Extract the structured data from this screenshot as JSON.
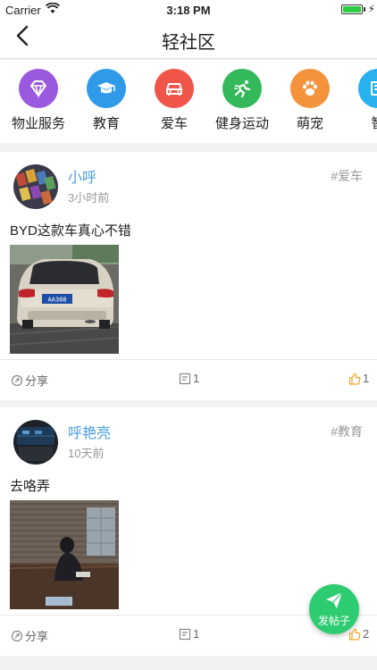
{
  "status_bar": {
    "carrier": "Carrier",
    "time": "3:18 PM"
  },
  "nav": {
    "title": "轻社区",
    "back_icon": "chevron-left-icon"
  },
  "categories": [
    {
      "label": "物业服务",
      "icon": "diamond-icon",
      "color": "#9b59e0"
    },
    {
      "label": "教育",
      "icon": "graduation-cap-icon",
      "color": "#2f9be8"
    },
    {
      "label": "爱车",
      "icon": "car-icon",
      "color": "#f0554a"
    },
    {
      "label": "健身运动",
      "icon": "running-icon",
      "color": "#33b95a"
    },
    {
      "label": "萌宠",
      "icon": "paw-icon",
      "color": "#f5923c"
    },
    {
      "label": "智",
      "icon": "smart-icon",
      "color": "#28b0ef"
    }
  ],
  "posts": [
    {
      "username": "小呼",
      "time_ago": "3小时前",
      "tag": "#爱车",
      "content": "BYD这款车真心不错",
      "share_label": "分享",
      "comments": "1",
      "likes": "1",
      "plate": "AA388"
    },
    {
      "username": "呼艳亮",
      "time_ago": "10天前",
      "tag": "#教育",
      "content": "去咯弄",
      "share_label": "分享",
      "comments": "1",
      "likes": "2"
    }
  ],
  "fab": {
    "label": "发帖子",
    "icon": "paper-plane-icon"
  },
  "colors": {
    "accent_green": "#2ecc71",
    "link_blue": "#4a9ee0",
    "like_orange": "#f5a623"
  }
}
